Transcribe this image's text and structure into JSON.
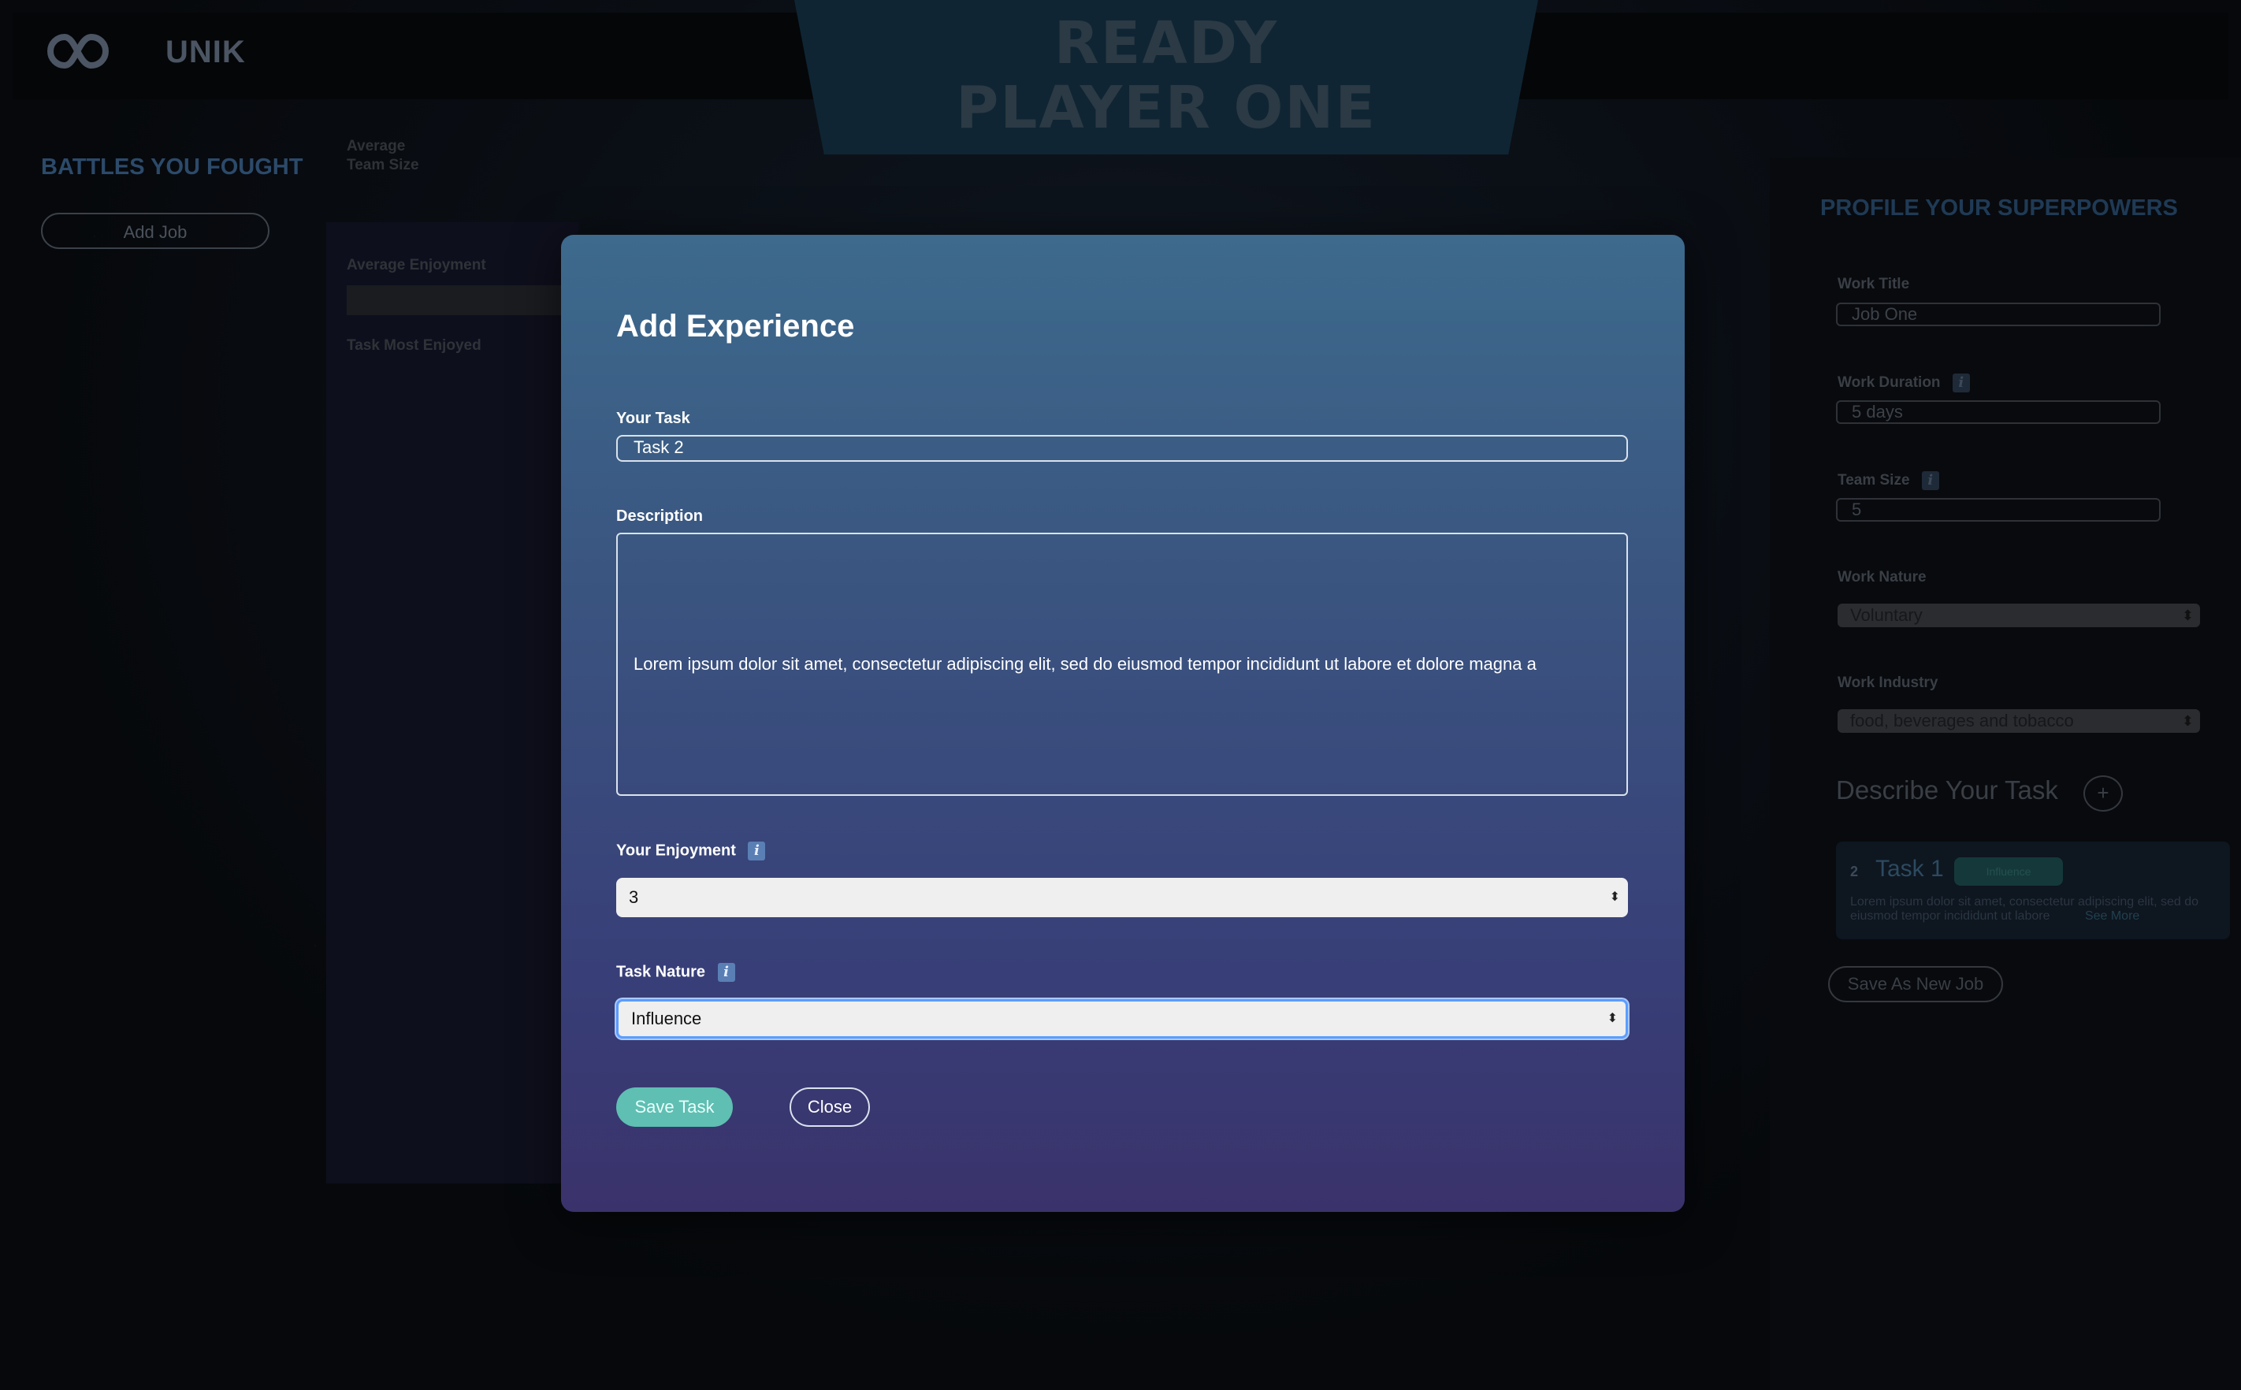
{
  "app": {
    "brand": "UNIK",
    "banner_line1": "READY",
    "banner_line2": "PLAYER ONE"
  },
  "left": {
    "title": "BATTLES YOU FOUGHT",
    "add_job": "Add Job"
  },
  "middle": {
    "avg_team_size_line1": "Average",
    "avg_team_size_line2": "Team Size",
    "avg_enjoyment": "Average Enjoyment",
    "task_most_enjoyed": "Task Most Enjoyed"
  },
  "right": {
    "title": "PROFILE YOUR SUPERPOWERS",
    "work_title_label": "Work Title",
    "work_title_value": "Job One",
    "work_duration_label": "Work Duration",
    "work_duration_value": "5 days",
    "team_size_label": "Team Size",
    "team_size_value": "5",
    "work_nature_label": "Work Nature",
    "work_nature_value": "Voluntary",
    "work_industry_label": "Work Industry",
    "work_industry_value": "food, beverages and tobacco",
    "describe_task": "Describe Your Task",
    "plus": "+",
    "task_card": {
      "num": "2",
      "title": "Task 1",
      "badge": "Influence",
      "desc": "Lorem ipsum dolor sit amet, consectetur adipiscing elit, sed do eiusmod tempor incididunt ut labore",
      "see_more": "See More"
    },
    "save_new_job": "Save As New Job",
    "info": "i"
  },
  "modal": {
    "title": "Add Experience",
    "task_label": "Your Task",
    "task_value": "Task 2",
    "description_label": "Description",
    "description_value": "Lorem ipsum dolor sit amet, consectetur adipiscing elit, sed do eiusmod tempor incididunt ut labore et dolore magna a",
    "enjoyment_label": "Your Enjoyment",
    "enjoyment_value": "3",
    "task_nature_label": "Task Nature",
    "task_nature_value": "Influence",
    "info": "i",
    "save_task": "Save Task",
    "close": "Close"
  },
  "colors": {
    "modal_top": "#3d6a8d",
    "modal_bottom": "#3a326b",
    "save_button": "#5fbfb2",
    "focus_ring": "#5b9dff"
  },
  "icons": {
    "logo": "infinity-icon",
    "info": "info-icon",
    "select_arrows": "select-arrows-icon"
  }
}
